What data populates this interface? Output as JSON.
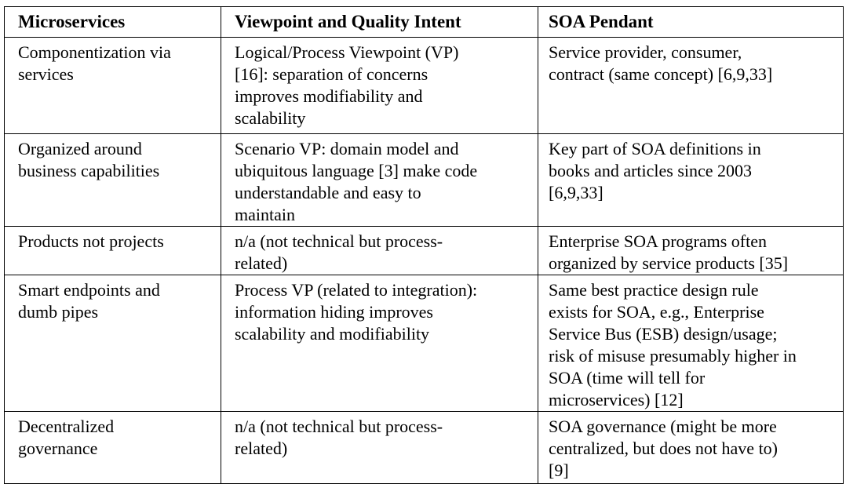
{
  "table": {
    "headers": [
      "Microservices",
      "Viewpoint and Quality Intent",
      "SOA Pendant"
    ],
    "rows": [
      [
        [
          "Componentization via",
          "services"
        ],
        [
          "Logical/Process Viewpoint (VP)",
          "[16]: separation of concerns",
          "improves modifiability and",
          "scalability"
        ],
        [
          "Service provider, consumer,",
          "contract (same concept) [6,9,33]"
        ]
      ],
      [
        [
          "Organized around",
          "business capabilities"
        ],
        [
          "Scenario VP: domain model and",
          "ubiquitous language [3] make code",
          "understandable and easy to",
          "maintain"
        ],
        [
          "Key part of SOA definitions in",
          "books and articles since 2003",
          "[6,9,33]"
        ]
      ],
      [
        [
          "Products not projects"
        ],
        [
          "n/a (not technical but process-",
          "related)"
        ],
        [
          "Enterprise SOA programs often",
          "organized by service products [35]"
        ]
      ],
      [
        [
          "Smart endpoints and",
          "dumb pipes"
        ],
        [
          "Process VP (related to integration):",
          "information hiding improves",
          "scalability and modifiability"
        ],
        [
          "Same best practice design rule",
          "exists for SOA, e.g., Enterprise",
          "Service Bus (ESB) design/usage;",
          "risk of misuse presumably higher in",
          "SOA (time will tell for",
          "microservices) [12]"
        ]
      ],
      [
        [
          "Decentralized",
          "governance"
        ],
        [
          "n/a (not technical but process-",
          "related)"
        ],
        [
          "SOA governance (might be more",
          "centralized, but does not have to)",
          "[9]"
        ]
      ]
    ]
  }
}
